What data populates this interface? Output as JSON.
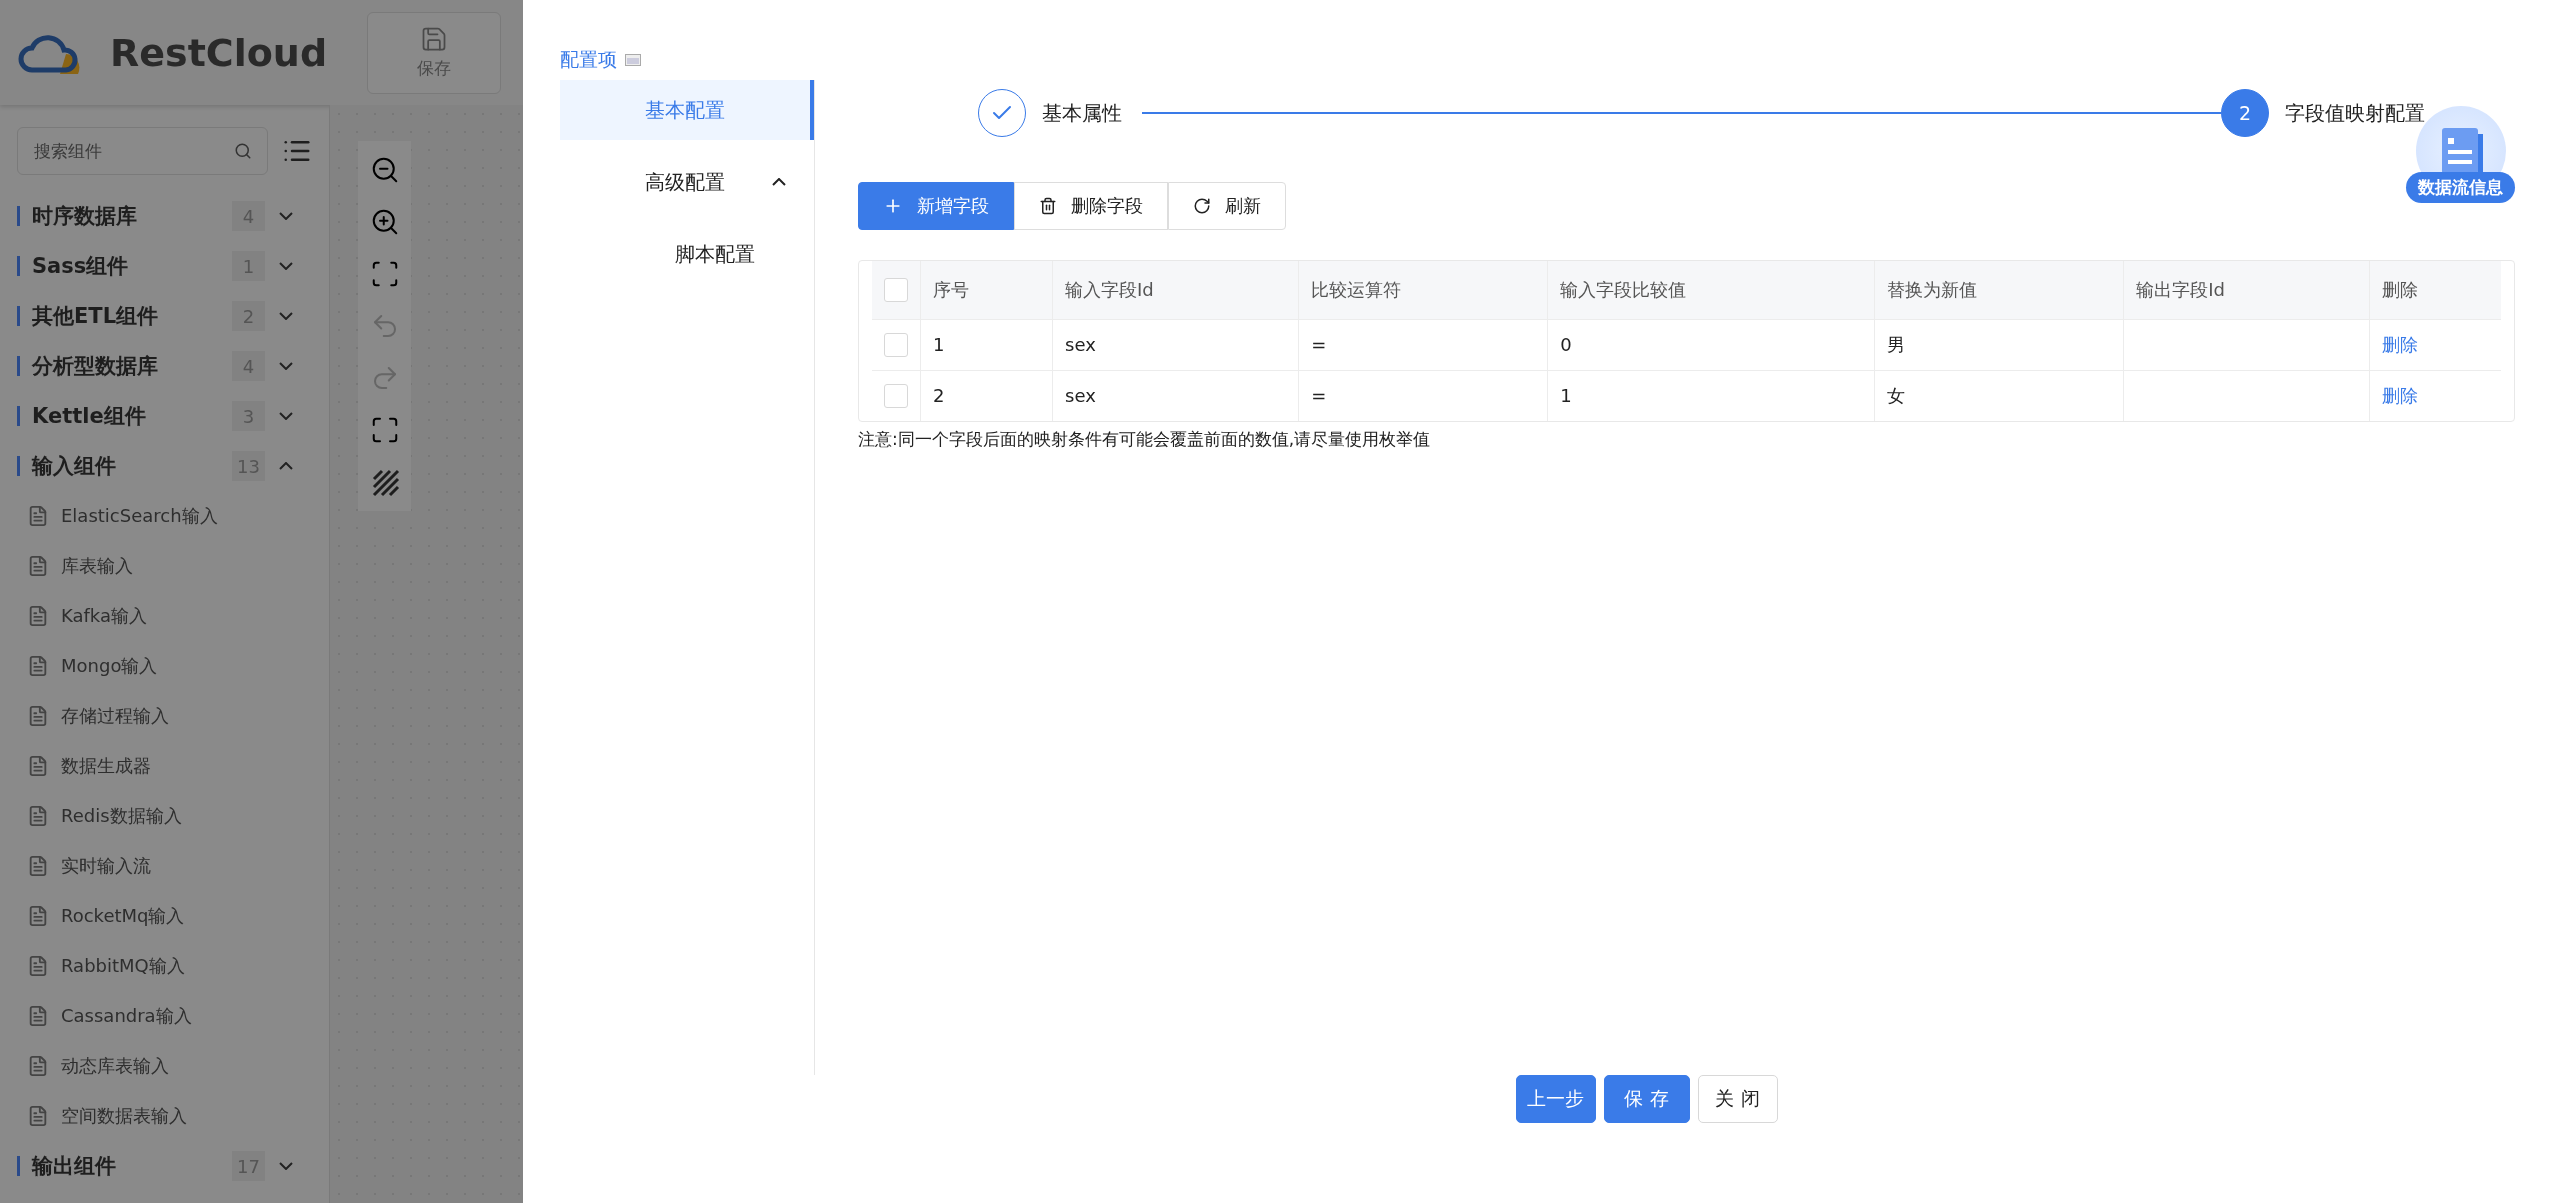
{
  "app": {
    "logo_text": "RestCloud",
    "save_button": "保存",
    "search": {
      "placeholder": "搜索组件"
    },
    "groups": [
      {
        "label": "时序数据库",
        "count": "4",
        "expanded": false
      },
      {
        "label": "Sass组件",
        "count": "1",
        "expanded": false
      },
      {
        "label": "其他ETL组件",
        "count": "2",
        "expanded": false
      },
      {
        "label": "分析型数据库",
        "count": "4",
        "expanded": false
      },
      {
        "label": "Kettle组件",
        "count": "3",
        "expanded": false
      },
      {
        "label": "输入组件",
        "count": "13",
        "expanded": true,
        "children": [
          "ElasticSearch输入",
          "库表输入",
          "Kafka输入",
          "Mongo输入",
          "存储过程输入",
          "数据生成器",
          "Redis数据输入",
          "实时输入流",
          "RocketMq输入",
          "RabbitMQ输入",
          "Cassandra输入",
          "动态库表输入",
          "空间数据表输入"
        ]
      },
      {
        "label": "输出组件",
        "count": "17",
        "expanded": false
      }
    ]
  },
  "drawer": {
    "config_title": "配置项",
    "menu": [
      {
        "label": "基本配置",
        "selected": true
      },
      {
        "label": "高级配置",
        "selected": false,
        "expanded": true,
        "children": [
          {
            "label": "脚本配置",
            "selected": false
          }
        ]
      }
    ],
    "steps": [
      {
        "title": "基本属性",
        "done": true
      },
      {
        "number": "2",
        "title": "字段值映射配置",
        "done": false
      }
    ],
    "float_badge": "数据流信息",
    "toolbar": [
      {
        "label": "新增字段",
        "kind": "add",
        "primary": true
      },
      {
        "label": "删除字段",
        "kind": "delete",
        "primary": false
      },
      {
        "label": "刷新",
        "kind": "refresh",
        "primary": false
      }
    ],
    "table": {
      "select_all_checked": false,
      "columns": [
        "序号",
        "输入字段Id",
        "比较运算符",
        "输入字段比较值",
        "替换为新值",
        "输出字段Id",
        "删除"
      ],
      "rows": [
        {
          "checked": false,
          "cells": [
            "1",
            "sex",
            "=",
            "0",
            "男",
            ""
          ],
          "action": "删除"
        },
        {
          "checked": false,
          "cells": [
            "2",
            "sex",
            "=",
            "1",
            "女",
            ""
          ],
          "action": "删除"
        }
      ]
    },
    "note": "注意:同一个字段后面的映射条件有可能会覆盖前面的数值,请尽量使用枚举值",
    "footer_buttons": [
      {
        "label": "上一步",
        "primary": true
      },
      {
        "label": "保 存",
        "primary": true
      },
      {
        "label": "关 闭",
        "primary": false
      }
    ]
  }
}
